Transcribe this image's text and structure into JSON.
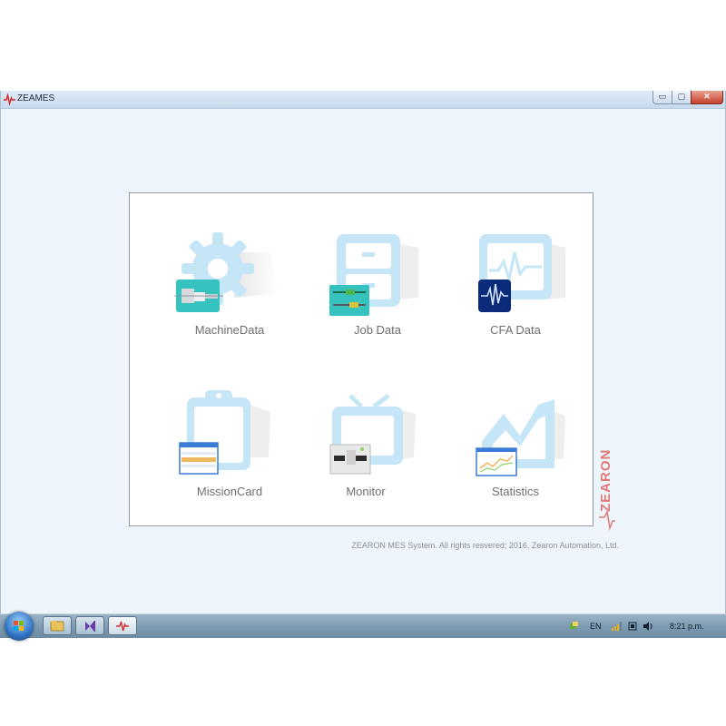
{
  "window": {
    "title": "ZEAMES",
    "controls": {
      "minimize": "▭",
      "maximize": "▢",
      "close": "✕"
    }
  },
  "tiles": [
    {
      "id": "machine-data",
      "label": "MachineData",
      "icon": "gear-icon"
    },
    {
      "id": "job-data",
      "label": "Job Data",
      "icon": "cabinet-icon"
    },
    {
      "id": "cfa-data",
      "label": "CFA Data",
      "icon": "waveform-monitor-icon"
    },
    {
      "id": "mission-card",
      "label": "MissionCard",
      "icon": "clipboard-icon"
    },
    {
      "id": "monitor",
      "label": "Monitor",
      "icon": "tv-monitor-icon"
    },
    {
      "id": "statistics",
      "label": "Statistics",
      "icon": "chart-icon"
    }
  ],
  "brand": {
    "text": "ZEARON",
    "color": "#d9534f"
  },
  "footer": {
    "text": "ZEARON MES System. All rights resvered; 2016, Zearon Automation, Ltd."
  },
  "taskbar": {
    "language": "EN",
    "clock": "8:21 p.m."
  },
  "colors": {
    "tile_light_blue": "#c5e6f6",
    "teal": "#36c3c0",
    "navy": "#0a2a7a"
  }
}
